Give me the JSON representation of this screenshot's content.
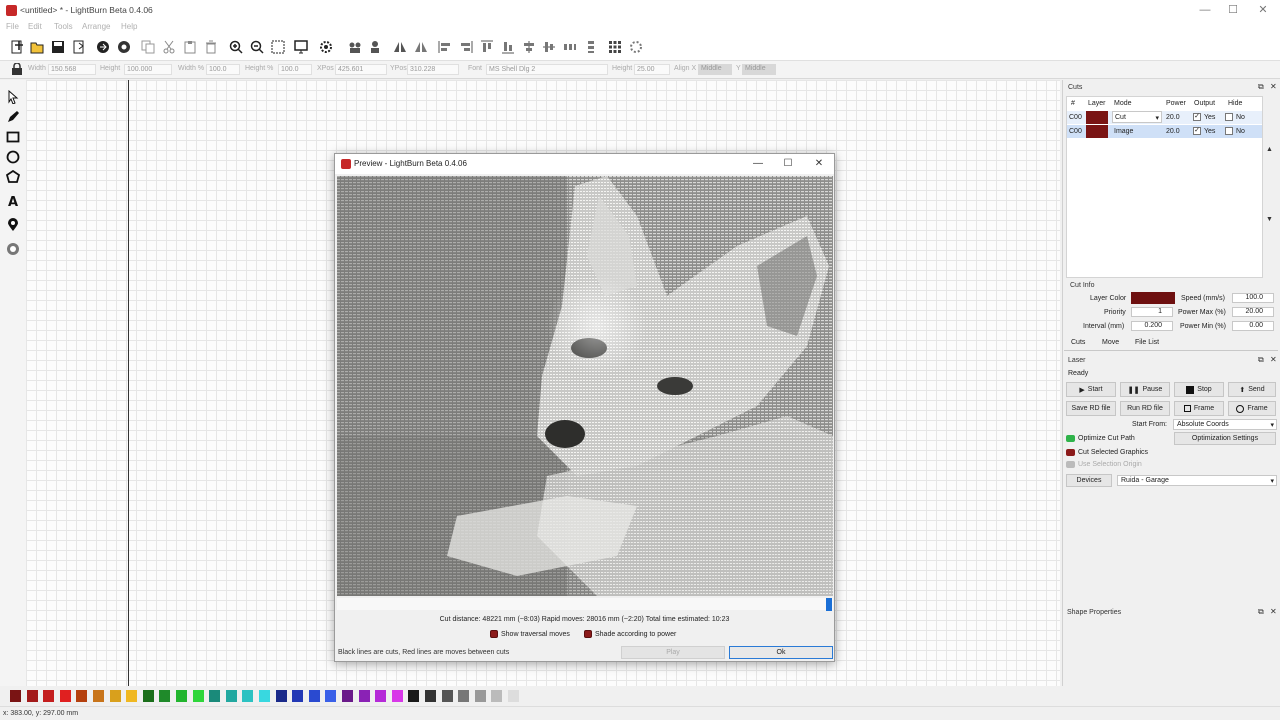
{
  "window": {
    "title": "<untitled> * - LightBurn Beta 0.4.06",
    "controls": [
      "—",
      "☐",
      "✕"
    ]
  },
  "menu": [
    "File",
    "Edit",
    "Tools",
    "Arrange",
    "Help"
  ],
  "props": {
    "width_label": "Width",
    "width_value": "150.568",
    "height_label": "Height",
    "height_value": "100.000",
    "width_pct_label": "Width %",
    "width_pct_value": "100.0",
    "height_pct_label": "Height %",
    "height_pct_value": "100.0",
    "xpos_label": "XPos",
    "xpos_value": "425.601",
    "ypos_label": "YPos",
    "ypos_value": "310.228",
    "font_label": "Font",
    "font_value": "MS Shell Dlg 2",
    "font_height_label": "Height",
    "font_height_value": "25.00",
    "align_x_label": "Align X",
    "align_x_value": "Middle",
    "align_y_label": "Y",
    "align_y_value": "Middle"
  },
  "dialog": {
    "title": "Preview - LightBurn Beta 0.4.06",
    "controls": [
      "—",
      "☐",
      "✕"
    ],
    "stats": "Cut distance: 48221 mm (~8:03)   Rapid moves: 28016 mm (~2:20)   Total time estimated: 10:23",
    "show_traversal": "Show traversal moves",
    "shade_power": "Shade according to power",
    "note": "Black lines are cuts, Red lines are moves between cuts",
    "play": "Play",
    "ok": "Ok",
    "progress": 1.0
  },
  "cuts_panel": {
    "title": "Cuts",
    "headers": [
      "#",
      "Layer",
      "Mode",
      "Power",
      "Output",
      "Hide"
    ],
    "rows": [
      {
        "num": "C00",
        "mode": "Cut",
        "power": "20.0",
        "output": "Yes",
        "hide": "No",
        "color": "#7a1414"
      },
      {
        "num": "C00",
        "mode": "Image",
        "power": "20.0",
        "output": "Yes",
        "hide": "No",
        "color": "#7a1414"
      }
    ]
  },
  "cut_info": {
    "title": "Cut Info",
    "layer_color_label": "Layer Color",
    "speed_label": "Speed (mm/s)",
    "speed_value": "100.0",
    "priority_label": "Priority",
    "priority_value": "1",
    "power_max_label": "Power Max (%)",
    "power_max_value": "20.00",
    "interval_label": "Interval (mm)",
    "interval_value": "0.200",
    "power_min_label": "Power Min (%)",
    "power_min_value": "0.00"
  },
  "tabs": [
    "Cuts",
    "Move",
    "File List"
  ],
  "laser": {
    "title": "Laser",
    "status": "Ready",
    "start": "Start",
    "pause": "Pause",
    "stop": "Stop",
    "send": "Send",
    "save_rd": "Save RD file",
    "run_rd": "Run RD file",
    "frame1": "Frame",
    "frame2": "Frame",
    "start_from_label": "Start From:",
    "start_from_value": "Absolute Coords",
    "optimize": "Optimize Cut Path",
    "optimization_settings": "Optimization Settings",
    "cut_selected": "Cut Selected Graphics",
    "use_selection": "Use Selection Origin",
    "devices": "Devices",
    "device_value": "Ruida - Garage"
  },
  "shape_properties": {
    "title": "Shape Properties"
  },
  "palette": [
    "#7a1414",
    "#a31a1a",
    "#c41e1e",
    "#e02020",
    "#b5400e",
    "#c8741a",
    "#d9a01c",
    "#f0b821",
    "#1a6e1a",
    "#1f8a2a",
    "#22b52e",
    "#2ed63a",
    "#1a8a7a",
    "#22a8a0",
    "#2cc2c2",
    "#38d8e0",
    "#1a2a8a",
    "#2238b5",
    "#2a4ad0",
    "#3a60e8",
    "#6a1a8a",
    "#8a22b5",
    "#b52ad8",
    "#d838e8",
    "#1a1a1a",
    "#333333",
    "#555555",
    "#777777",
    "#999999",
    "#bbbbbb",
    "#dddddd"
  ],
  "status": "x: 383.00, y: 297.00 mm"
}
